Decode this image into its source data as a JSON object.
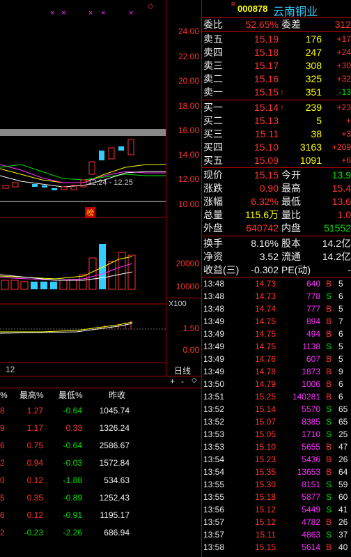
{
  "header": {
    "badge": "R",
    "code": "000878",
    "name": "云南铜业",
    "star": "◇"
  },
  "price_axis": [
    "24.00",
    "22.00",
    "20.00",
    "18.00",
    "16.00",
    "14.00",
    "12.00",
    "10.00"
  ],
  "volume_axis": [
    "20000",
    "10000",
    "X100"
  ],
  "macd_axis": [
    "1.50",
    "0.00"
  ],
  "ma_text": "12.24 - 12.25",
  "bang_label": "榜",
  "period_label": "日线",
  "date_fragment": "12",
  "nav_buttons": [
    "+",
    "-",
    "◇"
  ],
  "compare_table": {
    "headers": [
      "%",
      "最高%",
      "最低%",
      "昨收"
    ],
    "rows": [
      {
        "a": "8",
        "b": "1.27",
        "c": "-0.64",
        "d": "1045.74"
      },
      {
        "a": "9",
        "b": "1.17",
        "c": "0.33",
        "d": "1326.24"
      },
      {
        "a": "6",
        "b": "0.75",
        "c": "-0.64",
        "d": "2586.67"
      },
      {
        "a": "2",
        "b": "0.94",
        "c": "-0.03",
        "d": "1572.84"
      },
      {
        "a": "0",
        "b": "0.12",
        "c": "-1.88",
        "d": "534.63"
      },
      {
        "a": "5",
        "b": "0.35",
        "c": "-0.89",
        "d": "1252.43"
      },
      {
        "a": "6",
        "b": "0.12",
        "c": "-0.91",
        "d": "1195.17"
      },
      {
        "a": "2",
        "b": "-0.23",
        "c": "-2.26",
        "d": "686.94"
      }
    ]
  },
  "weibi": {
    "label1": "委比",
    "value1": "52.65%",
    "label2": "委差",
    "value2": "312"
  },
  "sells": [
    {
      "label": "卖五",
      "price": "15.19",
      "vol": "176",
      "chg": "+17"
    },
    {
      "label": "卖四",
      "price": "15.18",
      "vol": "247",
      "chg": "+24"
    },
    {
      "label": "卖三",
      "price": "15.17",
      "vol": "308",
      "chg": "+30"
    },
    {
      "label": "卖二",
      "price": "15.16",
      "vol": "325",
      "chg": "+32"
    },
    {
      "label": "卖一",
      "price": "15.15",
      "arrow": "↑",
      "vol": "351",
      "chg": "-13"
    }
  ],
  "buys": [
    {
      "label": "买一",
      "price": "15.14",
      "arrow": "↑",
      "vol": "239",
      "chg": "+23"
    },
    {
      "label": "买二",
      "price": "15.13",
      "vol": "5",
      "chg": "+"
    },
    {
      "label": "买三",
      "price": "15.11",
      "vol": "38",
      "chg": "+3"
    },
    {
      "label": "买四",
      "price": "15.10",
      "vol": "3163",
      "chg": "+209"
    },
    {
      "label": "买五",
      "price": "15.09",
      "vol": "1091",
      "chg": "+6"
    }
  ],
  "quote": [
    {
      "l1": "现价",
      "v1": "15.15",
      "l2": "今开",
      "v2": "13.9"
    },
    {
      "l1": "涨跌",
      "v1": "0.90",
      "l2": "最高",
      "v2": "15.4"
    },
    {
      "l1": "涨幅",
      "v1": "6.32%",
      "l2": "最低",
      "v2": "13.6"
    },
    {
      "l1": "总量",
      "v1": "115.6万",
      "l2": "量比",
      "v2": "1.0"
    },
    {
      "l1": "外盘",
      "v1": "640742",
      "l2": "内盘",
      "v2": "51552"
    }
  ],
  "fund": [
    {
      "l1": "换手",
      "v1": "8.16%",
      "l2": "股本",
      "v2": "14.2亿"
    },
    {
      "l1": "净资",
      "v1": "3.52",
      "l2": "流通",
      "v2": "14.2亿"
    },
    {
      "l1": "收益(三)",
      "v1": "-0.302",
      "l2": "PE(动)",
      "v2": "-"
    }
  ],
  "trades": [
    {
      "t": "13:48",
      "p": "14.73",
      "v": "640",
      "s": "B",
      "n": "5"
    },
    {
      "t": "13:48",
      "p": "14.73",
      "v": "778",
      "s": "S",
      "n": "6"
    },
    {
      "t": "13:48",
      "p": "14.74",
      "v": "777",
      "s": "B",
      "n": "5"
    },
    {
      "t": "13:49",
      "p": "14.75",
      "v": "894",
      "s": "B",
      "n": "7"
    },
    {
      "t": "13:49",
      "p": "14.75",
      "v": "494",
      "s": "B",
      "n": "6"
    },
    {
      "t": "13:49",
      "p": "14.75",
      "v": "1138",
      "s": "S",
      "n": "5"
    },
    {
      "t": "13:49",
      "p": "14.76",
      "v": "607",
      "s": "B",
      "n": "5"
    },
    {
      "t": "13:49",
      "p": "14.78",
      "v": "1873",
      "s": "B",
      "n": "9"
    },
    {
      "t": "13:50",
      "p": "14.79",
      "v": "1006",
      "s": "B",
      "n": "6"
    },
    {
      "t": "13:51",
      "p": "15.25",
      "v": "140281",
      "s": "B",
      "n": "6"
    },
    {
      "t": "13:52",
      "p": "15.14",
      "v": "5570",
      "s": "S",
      "n": "65"
    },
    {
      "t": "13:52",
      "p": "15.07",
      "v": "8385",
      "s": "S",
      "n": "65"
    },
    {
      "t": "13:53",
      "p": "15.05",
      "v": "1710",
      "s": "S",
      "n": "25"
    },
    {
      "t": "13:53",
      "p": "15.10",
      "v": "5655",
      "s": "B",
      "n": "47"
    },
    {
      "t": "13:54",
      "p": "15.23",
      "v": "5436",
      "s": "B",
      "n": "26"
    },
    {
      "t": "13:54",
      "p": "15.35",
      "v": "13653",
      "s": "B",
      "n": "64"
    },
    {
      "t": "13:55",
      "p": "15.30",
      "v": "8151",
      "s": "S",
      "n": "59"
    },
    {
      "t": "13:55",
      "p": "15.18",
      "v": "5877",
      "s": "S",
      "n": "60"
    },
    {
      "t": "13:56",
      "p": "15.12",
      "v": "5449",
      "s": "S",
      "n": "41"
    },
    {
      "t": "13:57",
      "p": "15.12",
      "v": "4782",
      "s": "B",
      "n": "26"
    },
    {
      "t": "13:57",
      "p": "15.11",
      "v": "4863",
      "s": "S",
      "n": "37"
    },
    {
      "t": "13:58",
      "p": "15.15",
      "v": "5614",
      "s": "B",
      "n": "40"
    }
  ]
}
